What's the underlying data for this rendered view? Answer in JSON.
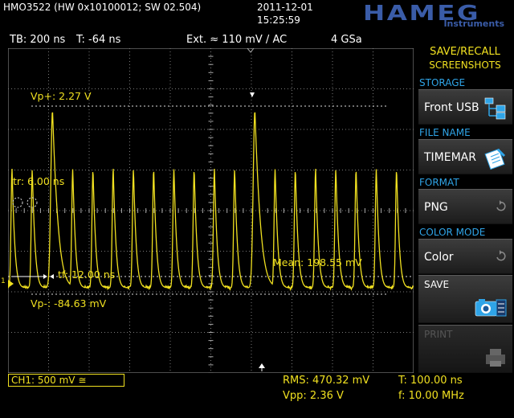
{
  "header": {
    "model": "HMO3522 (HW 0x10100012; SW 02.504)",
    "date": "2011-12-01",
    "time": "15:25:59",
    "logo_main": "HAMEG",
    "logo_sub": "Instruments"
  },
  "status_bar": {
    "timebase": "TB: 200 ns",
    "trigger_time": "T: -64 ns",
    "trigger": "Ext. ≈ 110 mV / AC",
    "sample_rate": "4 GSa"
  },
  "annotations": {
    "vp_plus": "Vp+: 2.27 V",
    "rise_time": "tr: 6.00 ns",
    "fall_time": "tf: 12.00 ns",
    "mean": "Mean: 198.55 mV",
    "vp_minus": "Vp-: -84.63 mV",
    "ground_marker": "1"
  },
  "menu": {
    "title_line1": "SAVE/RECALL",
    "title_line2": "SCREENSHOTS",
    "storage_label": "STORAGE",
    "storage_value": "Front USB",
    "file_name_label": "FILE NAME",
    "file_name_value": "TIMEMAR",
    "format_label": "FORMAT",
    "format_value": "PNG",
    "color_mode_label": "COLOR MODE",
    "color_mode_value": "Color",
    "save_label": "SAVE",
    "print_label": "PRINT"
  },
  "channel": {
    "ch1": "CH1: 500 mV ≅"
  },
  "measurements": {
    "rms": "RMS: 470.32 mV",
    "vpp": "Vpp: 2.36 V",
    "period": "T: 100.00 ns",
    "frequency": "f: 10.00 MHz"
  },
  "colors": {
    "trace": "#f0e020",
    "accent_blue": "#2fa4e7",
    "logo_blue": "#3a5ca8",
    "grid": "#888888"
  },
  "icons": {
    "storage": "usb-folder-icon",
    "file_name": "edit-document-icon",
    "format": "rotate-icon",
    "color_mode": "rotate-icon",
    "save": "camera-icon",
    "print": "printer-icon"
  }
}
